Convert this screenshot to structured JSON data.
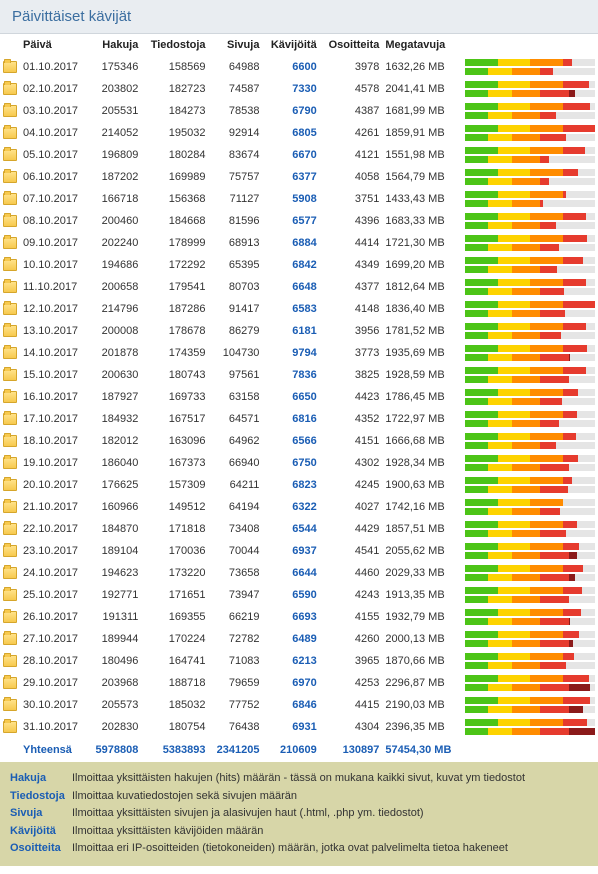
{
  "title": "Päivittäiset kävijät",
  "headers": {
    "date": "Päivä",
    "hits": "Hakuja",
    "files": "Tiedostoja",
    "pages": "Sivuja",
    "visitors": "Kävijöitä",
    "addresses": "Osoitteita",
    "mb": "Megatavuja"
  },
  "chart_data": {
    "type": "table",
    "title": "Päivittäiset kävijät",
    "columns": [
      "Päivä",
      "Hakuja",
      "Tiedostoja",
      "Sivuja",
      "Kävijöitä",
      "Osoitteita",
      "Megatavuja"
    ],
    "rows": [
      {
        "date": "01.10.2017",
        "hits": 175346,
        "files": 158569,
        "pages": 64988,
        "visitors": 6600,
        "addresses": 3978,
        "mb": "1632,26 MB"
      },
      {
        "date": "02.10.2017",
        "hits": 203802,
        "files": 182723,
        "pages": 74587,
        "visitors": 7330,
        "addresses": 4578,
        "mb": "2041,41 MB"
      },
      {
        "date": "03.10.2017",
        "hits": 205531,
        "files": 184273,
        "pages": 78538,
        "visitors": 6790,
        "addresses": 4387,
        "mb": "1681,99 MB"
      },
      {
        "date": "04.10.2017",
        "hits": 214052,
        "files": 195032,
        "pages": 92914,
        "visitors": 6805,
        "addresses": 4261,
        "mb": "1859,91 MB"
      },
      {
        "date": "05.10.2017",
        "hits": 196809,
        "files": 180284,
        "pages": 83674,
        "visitors": 6670,
        "addresses": 4121,
        "mb": "1551,98 MB"
      },
      {
        "date": "06.10.2017",
        "hits": 187202,
        "files": 169989,
        "pages": 75757,
        "visitors": 6377,
        "addresses": 4058,
        "mb": "1564,79 MB"
      },
      {
        "date": "07.10.2017",
        "hits": 166718,
        "files": 156368,
        "pages": 71127,
        "visitors": 5908,
        "addresses": 3751,
        "mb": "1433,43 MB"
      },
      {
        "date": "08.10.2017",
        "hits": 200460,
        "files": 184668,
        "pages": 81596,
        "visitors": 6577,
        "addresses": 4396,
        "mb": "1683,33 MB"
      },
      {
        "date": "09.10.2017",
        "hits": 202240,
        "files": 178999,
        "pages": 68913,
        "visitors": 6884,
        "addresses": 4414,
        "mb": "1721,30 MB"
      },
      {
        "date": "10.10.2017",
        "hits": 194686,
        "files": 172292,
        "pages": 65395,
        "visitors": 6842,
        "addresses": 4349,
        "mb": "1699,20 MB"
      },
      {
        "date": "11.10.2017",
        "hits": 200658,
        "files": 179541,
        "pages": 80703,
        "visitors": 6648,
        "addresses": 4377,
        "mb": "1812,64 MB"
      },
      {
        "date": "12.10.2017",
        "hits": 214796,
        "files": 187286,
        "pages": 91417,
        "visitors": 6583,
        "addresses": 4148,
        "mb": "1836,40 MB"
      },
      {
        "date": "13.10.2017",
        "hits": 200008,
        "files": 178678,
        "pages": 86279,
        "visitors": 6181,
        "addresses": 3956,
        "mb": "1781,52 MB"
      },
      {
        "date": "14.10.2017",
        "hits": 201878,
        "files": 174359,
        "pages": 104730,
        "visitors": 9794,
        "addresses": 3773,
        "mb": "1935,69 MB"
      },
      {
        "date": "15.10.2017",
        "hits": 200630,
        "files": 180743,
        "pages": 97561,
        "visitors": 7836,
        "addresses": 3825,
        "mb": "1928,59 MB"
      },
      {
        "date": "16.10.2017",
        "hits": 187927,
        "files": 169733,
        "pages": 63158,
        "visitors": 6650,
        "addresses": 4423,
        "mb": "1786,45 MB"
      },
      {
        "date": "17.10.2017",
        "hits": 184932,
        "files": 167517,
        "pages": 64571,
        "visitors": 6816,
        "addresses": 4352,
        "mb": "1722,97 MB"
      },
      {
        "date": "18.10.2017",
        "hits": 182012,
        "files": 163096,
        "pages": 64962,
        "visitors": 6566,
        "addresses": 4151,
        "mb": "1666,68 MB"
      },
      {
        "date": "19.10.2017",
        "hits": 186040,
        "files": 167373,
        "pages": 66940,
        "visitors": 6750,
        "addresses": 4302,
        "mb": "1928,34 MB"
      },
      {
        "date": "20.10.2017",
        "hits": 176625,
        "files": 157309,
        "pages": 64211,
        "visitors": 6823,
        "addresses": 4245,
        "mb": "1900,63 MB"
      },
      {
        "date": "21.10.2017",
        "hits": 160966,
        "files": 149512,
        "pages": 64194,
        "visitors": 6322,
        "addresses": 4027,
        "mb": "1742,16 MB"
      },
      {
        "date": "22.10.2017",
        "hits": 184870,
        "files": 171818,
        "pages": 73408,
        "visitors": 6544,
        "addresses": 4429,
        "mb": "1857,51 MB"
      },
      {
        "date": "23.10.2017",
        "hits": 189104,
        "files": 170036,
        "pages": 70044,
        "visitors": 6937,
        "addresses": 4541,
        "mb": "2055,62 MB"
      },
      {
        "date": "24.10.2017",
        "hits": 194623,
        "files": 173220,
        "pages": 73658,
        "visitors": 6644,
        "addresses": 4460,
        "mb": "2029,33 MB"
      },
      {
        "date": "25.10.2017",
        "hits": 192771,
        "files": 171651,
        "pages": 73947,
        "visitors": 6590,
        "addresses": 4243,
        "mb": "1913,35 MB"
      },
      {
        "date": "26.10.2017",
        "hits": 191311,
        "files": 169355,
        "pages": 66219,
        "visitors": 6693,
        "addresses": 4155,
        "mb": "1932,79 MB"
      },
      {
        "date": "27.10.2017",
        "hits": 189944,
        "files": 170224,
        "pages": 72782,
        "visitors": 6489,
        "addresses": 4260,
        "mb": "2000,13 MB"
      },
      {
        "date": "28.10.2017",
        "hits": 180496,
        "files": 164741,
        "pages": 71083,
        "visitors": 6213,
        "addresses": 3965,
        "mb": "1870,66 MB"
      },
      {
        "date": "29.10.2017",
        "hits": 203968,
        "files": 188718,
        "pages": 79659,
        "visitors": 6970,
        "addresses": 4253,
        "mb": "2296,87 MB"
      },
      {
        "date": "30.10.2017",
        "hits": 205573,
        "files": 185032,
        "pages": 77752,
        "visitors": 6846,
        "addresses": 4415,
        "mb": "2190,03 MB"
      },
      {
        "date": "31.10.2017",
        "hits": 202830,
        "files": 180754,
        "pages": 76438,
        "visitors": 6931,
        "addresses": 4304,
        "mb": "2396,35 MB"
      }
    ],
    "totals": {
      "label": "Yhteensä",
      "hits": 5978808,
      "files": 5383893,
      "pages": 2341205,
      "visitors": 210609,
      "addresses": 130897,
      "mb": "57454,30 MB"
    }
  },
  "legend": [
    {
      "k": "Hakuja",
      "t": "Ilmoittaa yksittäisten hakujen (hits) määrän - tässä on mukana kaikki sivut, kuvat ym tiedostot"
    },
    {
      "k": "Tiedostoja",
      "t": "Ilmoittaa kuvatiedostojen sekä sivujen määrän"
    },
    {
      "k": "Sivuja",
      "t": "Ilmoittaa yksittäisten sivujen ja alasivujen haut (.html, .php ym. tiedostot)"
    },
    {
      "k": "Kävijöitä",
      "t": "Ilmoittaa yksittäisten kävijöiden määrän"
    },
    {
      "k": "Osoitteita",
      "t": "Ilmoittaa eri IP-osoitteiden (tietokoneiden) määrän, jotka ovat palvelimelta tietoa hakeneet"
    }
  ]
}
